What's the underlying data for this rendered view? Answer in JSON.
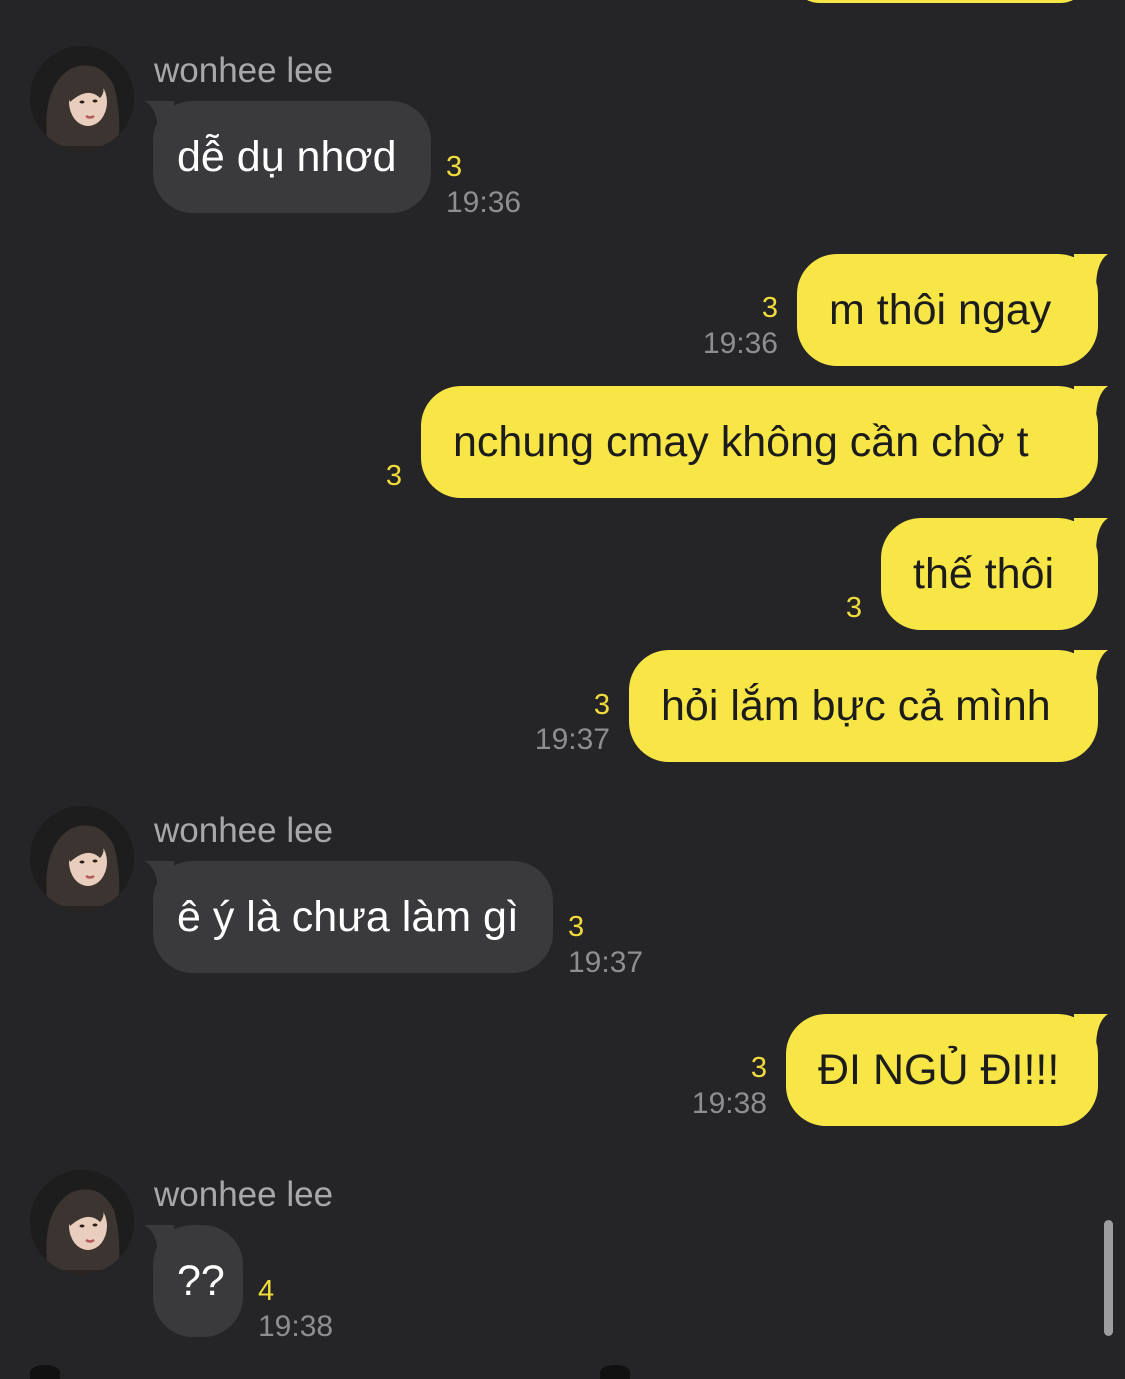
{
  "messages": [
    {
      "sender": "wonhee lee",
      "text": "dễ dụ nhơd",
      "count": "3",
      "time": "19:36"
    },
    {
      "text": "m thôi ngay",
      "count": "3",
      "time": "19:36"
    },
    {
      "text": "nchung cmay không cần chờ t",
      "count": "3"
    },
    {
      "text": "thế thôi",
      "count": "3"
    },
    {
      "text": "hỏi lắm bực cả mình",
      "count": "3",
      "time": "19:37"
    },
    {
      "sender": "wonhee lee",
      "text": "ê ý là chưa làm gì",
      "count": "3",
      "time": "19:37"
    },
    {
      "text": "ĐI NGỦ ĐI!!!",
      "count": "3",
      "time": "19:38"
    },
    {
      "sender": "wonhee lee",
      "text": "??",
      "count": "4",
      "time": "19:38"
    }
  ],
  "colors": {
    "background": "#252527",
    "incoming_bubble": "#3a3a3d",
    "outgoing_bubble": "#f8e647",
    "unread_count": "#f1db3c",
    "timestamp": "#8d8d92",
    "sender_name": "#a8a8ac"
  },
  "icons": {
    "avatar": "profile-photo"
  }
}
